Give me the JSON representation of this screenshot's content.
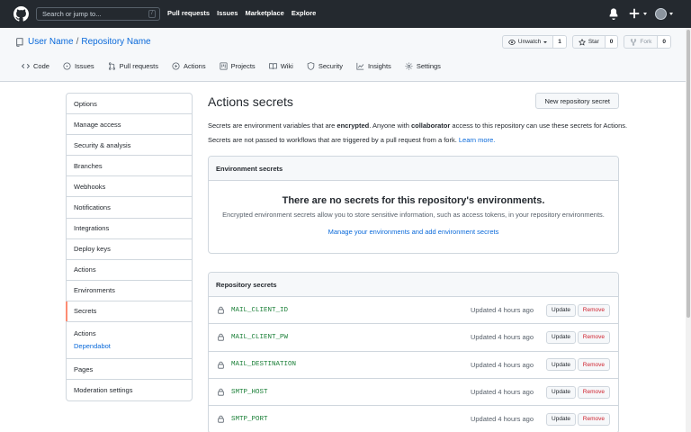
{
  "header": {
    "search_placeholder": "Search or jump to...",
    "search_shortcut": "/",
    "nav": [
      "Pull requests",
      "Issues",
      "Marketplace",
      "Explore"
    ]
  },
  "repo": {
    "owner": "User Name",
    "separator": "/",
    "name": "Repository Name",
    "watch_label": "Unwatch",
    "watch_count": "1",
    "star_label": "Star",
    "star_count": "0",
    "fork_label": "Fork",
    "fork_count": "0",
    "tabs": [
      "Code",
      "Issues",
      "Pull requests",
      "Actions",
      "Projects",
      "Wiki",
      "Security",
      "Insights",
      "Settings"
    ]
  },
  "sidebar": {
    "items_top": [
      "Options",
      "Manage access",
      "Security & analysis",
      "Branches",
      "Webhooks",
      "Notifications",
      "Integrations",
      "Deploy keys",
      "Actions",
      "Environments",
      "Secrets"
    ],
    "group_title": "Actions",
    "group_sub": "Dependabot",
    "items_bottom": [
      "Pages",
      "Moderation settings"
    ]
  },
  "main": {
    "title": "Actions secrets",
    "new_button": "New repository secret",
    "desc1_a": "Secrets are environment variables that are ",
    "desc1_b": "encrypted",
    "desc1_c": ". Anyone with ",
    "desc1_d": "collaborator",
    "desc1_e": " access to this repository can use these secrets for Actions.",
    "desc2": "Secrets are not passed to workflows that are triggered by a pull request from a fork. ",
    "desc2_link": "Learn more.",
    "env_header": "Environment secrets",
    "env_blank_title": "There are no secrets for this repository's environments.",
    "env_blank_desc": "Encrypted environment secrets allow you to store sensitive information, such as access tokens, in your repository environments.",
    "env_blank_link": "Manage your environments and add environment secrets",
    "repo_header": "Repository secrets",
    "update_label": "Update",
    "remove_label": "Remove",
    "secrets": [
      {
        "name": "MAIL_CLIENT_ID",
        "updated": "Updated 4 hours ago"
      },
      {
        "name": "MAIL_CLIENT_PW",
        "updated": "Updated 4 hours ago"
      },
      {
        "name": "MAIL_DESTINATION",
        "updated": "Updated 4 hours ago"
      },
      {
        "name": "SMTP_HOST",
        "updated": "Updated 4 hours ago"
      },
      {
        "name": "SMTP_PORT",
        "updated": "Updated 4 hours ago"
      }
    ]
  },
  "colors": {
    "header_bg": "#24292f",
    "link": "#0969da",
    "secret_name": "#1a7f37",
    "danger": "#cf222e",
    "selected_accent": "#fd8c73"
  }
}
